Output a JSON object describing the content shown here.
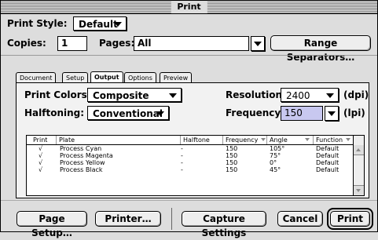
{
  "window": {
    "title": "Print"
  },
  "print_style": {
    "label": "Print Style:",
    "value": "Default"
  },
  "copies": {
    "label": "Copies:",
    "value": "1"
  },
  "pages": {
    "label": "Pages:",
    "value": "All"
  },
  "range_separators_button": "Range Separators…",
  "tabs": [
    "Document",
    "Setup",
    "Output",
    "Options",
    "Preview"
  ],
  "active_tab": "Output",
  "output": {
    "print_colors": {
      "label": "Print Colors:",
      "value": "Composite CMYK"
    },
    "halftoning": {
      "label": "Halftoning:",
      "value": "Conventional"
    },
    "resolution": {
      "label": "Resolution:",
      "value": "2400",
      "unit": "(dpi)"
    },
    "frequency": {
      "label": "Frequency:",
      "value": "150",
      "unit": "(lpi)"
    }
  },
  "plates_table": {
    "columns": [
      "Print",
      "Plate",
      "Halftone",
      "Frequency",
      "Angle",
      "Function"
    ],
    "rows": [
      {
        "print": "√",
        "plate": "Process Cyan",
        "halftone": "-",
        "frequency": "150",
        "angle": "105°",
        "function": "Default"
      },
      {
        "print": "√",
        "plate": "Process Magenta",
        "halftone": "-",
        "frequency": "150",
        "angle": "75°",
        "function": "Default"
      },
      {
        "print": "√",
        "plate": "Process Yellow",
        "halftone": "-",
        "frequency": "150",
        "angle": "0°",
        "function": "Default"
      },
      {
        "print": "√",
        "plate": "Process Black",
        "halftone": "-",
        "frequency": "150",
        "angle": "45°",
        "function": "Default"
      }
    ]
  },
  "buttons": {
    "page_setup": "Page Setup…",
    "printer": "Printer…",
    "capture_settings": "Capture Settings",
    "cancel": "Cancel",
    "print": "Print"
  },
  "colors": {
    "frequency_field_bg": "#c8c8f0"
  }
}
